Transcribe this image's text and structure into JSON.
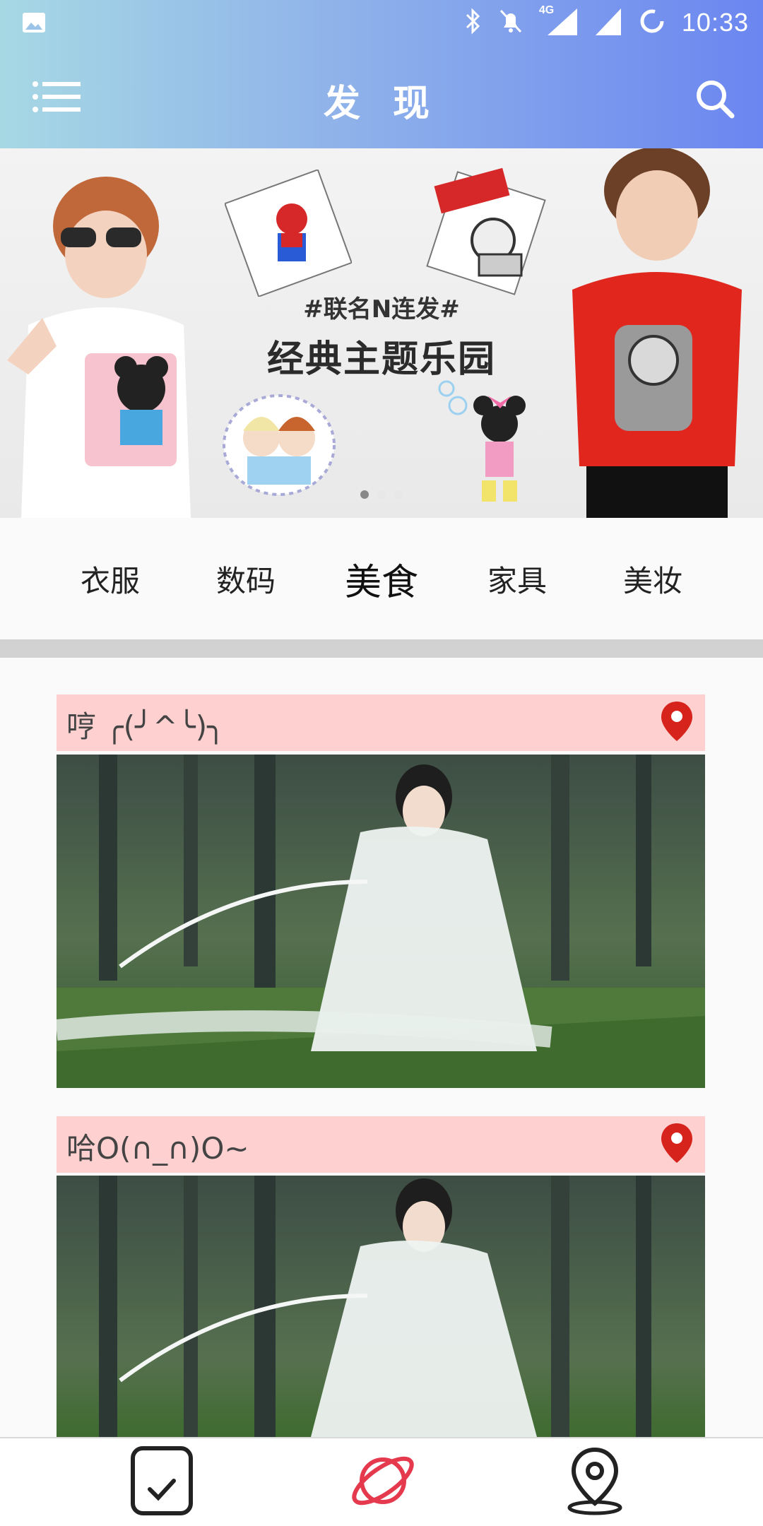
{
  "status_bar": {
    "time": "10:33",
    "network": "4G",
    "icons": [
      "image-icon",
      "bluetooth-icon",
      "mute-icon",
      "signal-icon",
      "wifi-icon",
      "sync-icon"
    ]
  },
  "app_bar": {
    "title": "发 现",
    "icons": [
      "menu-icon",
      "search-icon"
    ]
  },
  "banner": {
    "tag": "#联名N连发#",
    "headline": "经典主题乐园",
    "page_count": 3,
    "active_page": 1
  },
  "categories": {
    "items": [
      "衣服",
      "数码",
      "美食",
      "家具",
      "美妆"
    ],
    "active": "美食"
  },
  "feed": {
    "posts": [
      {
        "caption": "哼 ╭(╯^╰)╮",
        "icon": "location-pin-icon"
      },
      {
        "caption": "哈O(∩_∩)O~",
        "icon": "location-pin-icon"
      }
    ]
  },
  "bottom_nav": {
    "items": [
      {
        "icon": "task-check-icon"
      },
      {
        "icon": "planet-icon",
        "active": true
      },
      {
        "icon": "map-pin-icon"
      }
    ]
  },
  "colors": {
    "appbar_gradient_start": "#a6d8e4",
    "appbar_gradient_end": "#6b86f0",
    "caption_bg": "#ffd0d0",
    "pin_red": "#d6231c",
    "nav_active": "#e5394d"
  }
}
